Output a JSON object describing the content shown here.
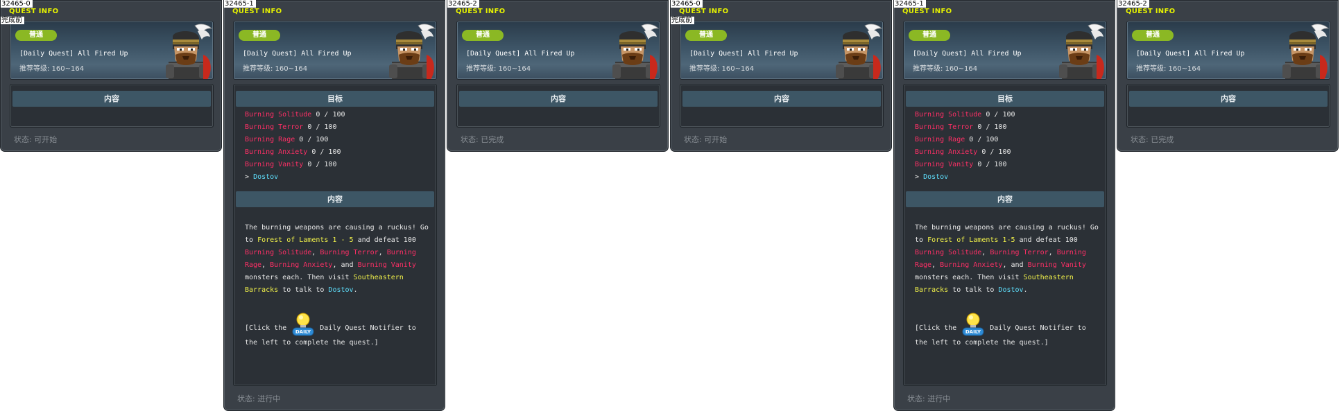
{
  "colors": {
    "title": "#e6f200",
    "badge": "#8bb824",
    "mob": "#ff2f66",
    "npc": "#5fe1ff",
    "place": "#f1f14a",
    "panel": "#3a4047",
    "section": "#3d5665"
  },
  "panels": [
    {
      "id": "32465-0",
      "subtitle": "完成前",
      "title": "QUEST INFO",
      "badge": "普通",
      "name": "[Daily Quest] All Fired Up",
      "level": "推荐等级: 160~164",
      "content_header": "内容",
      "status": "状态:  可开始"
    },
    {
      "id": "32465-1",
      "title": "QUEST INFO",
      "badge": "普通",
      "name": "[Daily Quest] All Fired Up",
      "level": "推荐等级: 160~164",
      "goal_header": "目标",
      "goals": [
        {
          "mob": "Burning Solitude",
          "count": "0 / 100"
        },
        {
          "mob": "Burning Terror",
          "count": "0 / 100"
        },
        {
          "mob": "Burning Rage",
          "count": "0 / 100"
        },
        {
          "mob": "Burning Anxiety",
          "count": "0 / 100"
        },
        {
          "mob": "Burning Vanity",
          "count": "0 / 100"
        }
      ],
      "npc_arrow": ">",
      "npc": "Dostov",
      "content_header": "内容",
      "desc": {
        "t1": "The burning weapons are causing a ruckus! Go to ",
        "place": "Forest of Laments 1 - 5",
        "t2": " and defeat 100 ",
        "m1": "Burning Solitude",
        "s1": ", ",
        "m2": "Burning Terror",
        "s2": ", ",
        "m3": "Burning Rage",
        "s3": ", ",
        "m4": "Burning Anxiety",
        "s4": ", and ",
        "m5": "Burning Vanity",
        "t3": " monsters each. Then visit ",
        "place2": "Southeastern Barracks",
        "t4": " to talk to ",
        "npc": "Dostov",
        "t5": "."
      },
      "notifier_pre": "[Click the ",
      "notifier_icon": "DAILY",
      "notifier_post": " Daily Quest Notifier to the left to complete the quest.]",
      "status": "状态:  进行中"
    },
    {
      "id": "32465-2",
      "title": "QUEST INFO",
      "badge": "普通",
      "name": "[Daily Quest] All Fired Up",
      "level": "推荐等级: 160~164",
      "content_header": "内容",
      "status": "状态:  已完成"
    },
    {
      "id": "32465-0",
      "subtitle": "完成前",
      "title": "QUEST INFO",
      "badge": "普通",
      "name": "[Daily Quest] All Fired Up",
      "level": "推荐等级: 160~164",
      "content_header": "内容",
      "status": "状态:  可开始"
    },
    {
      "id": "32465-1",
      "title": "QUEST INFO",
      "badge": "普通",
      "name": "[Daily Quest] All Fired Up",
      "level": "推荐等级: 160~164",
      "goal_header": "目标",
      "goals": [
        {
          "mob": "Burning Solitude",
          "count": "0 / 100"
        },
        {
          "mob": "Burning Terror",
          "count": "0 / 100"
        },
        {
          "mob": "Burning Rage",
          "count": "0 / 100"
        },
        {
          "mob": "Burning Anxiety",
          "count": "0 / 100"
        },
        {
          "mob": "Burning Vanity",
          "count": "0 / 100"
        }
      ],
      "npc_arrow": ">",
      "npc": "Dostov",
      "content_header": "内容",
      "desc": {
        "t1": "The burning weapons are causing a ruckus! Go to ",
        "place": "Forest of Laments 1-5",
        "t2": " and defeat 100 ",
        "m1": "Burning Solitude",
        "s1": ", ",
        "m2": "Burning Terror",
        "s2": ", ",
        "m3": "Burning Rage",
        "s3": ", ",
        "m4": "Burning Anxiety",
        "s4": ", and ",
        "m5": "Burning Vanity",
        "t3": " monsters each. Then visit ",
        "place2": "Southeastern Barracks",
        "t4": " to talk to ",
        "npc": "Dostov",
        "t5": "."
      },
      "notifier_pre": "[Click the ",
      "notifier_icon": "DAILY",
      "notifier_post": " Daily Quest Notifier to the left to complete the quest.]",
      "status": "状态:  进行中"
    },
    {
      "id": "32465-2",
      "title": "QUEST INFO",
      "badge": "普通",
      "name": "[Daily Quest] All Fired Up",
      "level": "推荐等级: 160~164",
      "content_header": "内容",
      "status": "状态:  已完成"
    }
  ]
}
